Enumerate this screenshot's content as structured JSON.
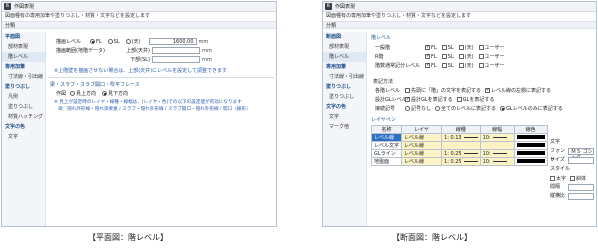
{
  "left": {
    "window_title": "作図表現",
    "description": "図面種有の専用加筆や塗りつぶし・材質・文字などを設定します",
    "classification": "分類",
    "sidebar": [
      {
        "type": "cat",
        "label": "平面図"
      },
      {
        "type": "item",
        "label": "部材表現"
      },
      {
        "type": "item",
        "label": "階レベル",
        "active": true
      },
      {
        "type": "cat",
        "label": "専用加筆"
      },
      {
        "type": "item",
        "label": "寸法線・引出線"
      },
      {
        "type": "cat",
        "label": "塗りつぶし"
      },
      {
        "type": "item",
        "label": "凡例"
      },
      {
        "type": "item",
        "label": "塗りつぶし"
      },
      {
        "type": "item",
        "label": "材質ハッチング"
      },
      {
        "type": "cat",
        "label": "文字の色"
      },
      {
        "type": "item",
        "label": "文字"
      }
    ],
    "level_label": "描画レベル",
    "radio_fl": "FL",
    "radio_sl": "SL",
    "radio_ceiling": "(天)",
    "level_value": "1600.00",
    "unit_mm": "mm",
    "range_label": "描画範囲(地階データ)",
    "upper_label": "上部(天井)",
    "lower_label": "下部(SL)",
    "note1": "※上階壁を描画させない場合は、上部(天井)にレベルを設定して調整できます",
    "section_title": "梁・スラブ・スラブ開口・吹平フレース",
    "display_label": "作図",
    "radio_see_up": "見上方向",
    "radio_see_down": "見下方向",
    "note2": "※ 見上が設定時のレイヤ・線種・線幅は、[レイヤ・色]での以下の設定値が有効になります",
    "note3": "梁：隠れ外形線・隠れ梁要素 / スラブ・隠れ外形線 / スラブ開口・隠れ外形線 / 開口（線形）"
  },
  "right": {
    "window_title": "作図表現",
    "description": "図面種有の専用加筆や塗りつぶし・材質・文字などを設定します",
    "classification": "分類",
    "sidebar": [
      {
        "type": "cat",
        "label": "断面図"
      },
      {
        "type": "item",
        "label": "部材表現"
      },
      {
        "type": "item",
        "label": "階レベル",
        "active": true
      },
      {
        "type": "cat",
        "label": "専用加筆"
      },
      {
        "type": "item",
        "label": "寸法線・引出線"
      },
      {
        "type": "cat",
        "label": "塗りつぶし"
      },
      {
        "type": "item",
        "label": "塗りつぶし"
      },
      {
        "type": "cat",
        "label": "文字の色"
      },
      {
        "type": "item",
        "label": "文字"
      },
      {
        "type": "item",
        "label": "マーク他"
      }
    ],
    "level_section": "階レベル",
    "rows": [
      {
        "label": "一般階",
        "checks": [
          true,
          false,
          false,
          false
        ]
      },
      {
        "label": "R階",
        "checks": [
          true,
          false,
          false,
          false
        ]
      },
      {
        "label": "階数通常記分レベル",
        "checks": [
          true,
          false,
          false,
          false
        ]
      }
    ],
    "check_labels": [
      "FL",
      "SL",
      "(天)",
      "ユーザー"
    ],
    "display_method": "表記方法",
    "method_rows": [
      {
        "label": "各階レベル",
        "options": [
          {
            "text": "先頭に「階」の文字を表記する",
            "on": false
          },
          {
            "text": "レベル線の左側に表記する",
            "on": true
          }
        ]
      },
      {
        "label": "設計GLレベル",
        "options": [
          {
            "text": "設計GLを表記する",
            "on": true
          },
          {
            "text": "GLを表記する",
            "on": false
          }
        ]
      },
      {
        "label": "接続記号",
        "options": [
          {
            "text": "記号なし",
            "on": false
          },
          {
            "text": "全てのレベルに表記する",
            "on": false
          },
          {
            "text": "GLレベルのみに表記する",
            "on": true
          }
        ]
      }
    ],
    "layer_title": "レイヤペン",
    "table_headers": [
      "名称",
      "レイヤ",
      "線種",
      "線幅",
      "線色"
    ],
    "table_rows": [
      {
        "name": "レベル線",
        "layer": "レベル線",
        "ltype": "1: 0.13",
        "lwidth": "10:",
        "sel": true
      },
      {
        "name": "レベル文字",
        "layer": "レベル線",
        "ltype": "",
        "lwidth": "",
        "sel": false
      },
      {
        "name": "GLライン",
        "layer": "レベル線",
        "ltype": "1: 0.25",
        "lwidth": "10:",
        "sel": false
      },
      {
        "name": "地盤面",
        "layer": "レベル線",
        "ltype": "1: 0.25",
        "lwidth": "10:",
        "sel": false
      }
    ],
    "text_panel_title": "文字",
    "font_label": "フォント",
    "font_value": "ＭＳ ゴシック",
    "size_label": "サイズ",
    "style_label": "スタイル",
    "bold_label": "太字",
    "italic_label": "斜体",
    "spacing_label": "間隔",
    "ratio_label": "縦横比"
  },
  "captions": {
    "left": "【平面図：階レベル】",
    "right": "【断面図：階レベル】"
  }
}
